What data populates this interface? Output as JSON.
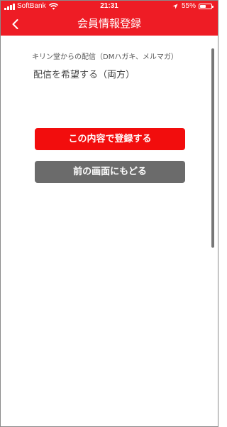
{
  "status_bar": {
    "carrier": "SoftBank",
    "time": "21:31",
    "battery_percent": "55%",
    "battery_level": 0.55,
    "icons": [
      "signal-icon",
      "wifi-icon",
      "location-arrow-icon",
      "battery-icon"
    ]
  },
  "header": {
    "title": "会員情報登録",
    "back_icon": "chevron-left-icon"
  },
  "form": {
    "field_label": "キリン堂からの配信（DMハガキ、メルマガ）",
    "field_value": "配信を希望する（両方）"
  },
  "actions": {
    "submit_label": "この内容で登録する",
    "back_label": "前の画面にもどる"
  },
  "colors": {
    "brand_red": "#ee1c25",
    "primary_button": "#f20d0d",
    "secondary_button": "#6b6b6b"
  }
}
